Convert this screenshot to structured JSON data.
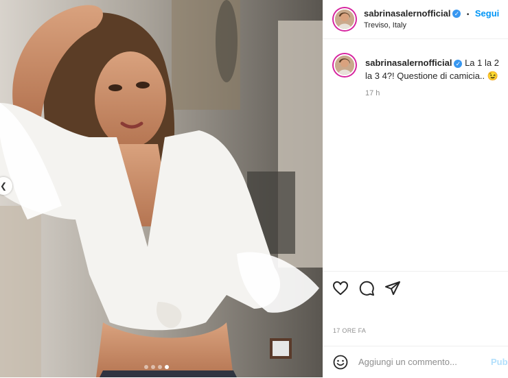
{
  "post": {
    "username": "sabrinasalernofficial",
    "follow_label": "Segui",
    "separator": "•",
    "location": "Treviso, Italy",
    "caption": "La 1 la 2 la 3 4?! Questione di camicia.. 😉",
    "caption_time": "17 h",
    "time_ago": "17 ORE FA",
    "comment_placeholder": "Aggiungi un commento...",
    "publish_label": "Pub",
    "carousel": {
      "total": 4,
      "active_index": 3
    }
  },
  "colors": {
    "accent": "#0095f6",
    "verified": "#3897f0",
    "story_ring": "#d6249f"
  },
  "icons": [
    "chevron-left-icon",
    "verified-badge-icon",
    "heart-icon",
    "comment-icon",
    "share-icon",
    "emoji-icon"
  ]
}
